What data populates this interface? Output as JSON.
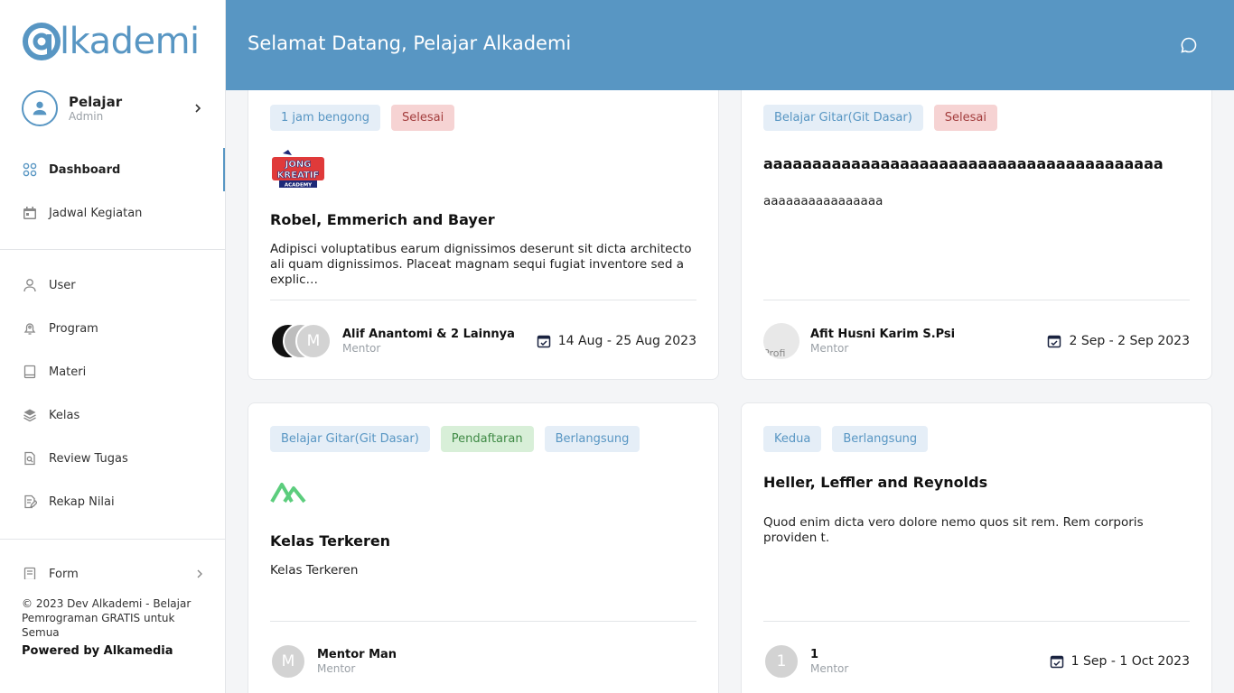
{
  "brand": {
    "logo_text": "lkademi",
    "logo_mark_letter": "a",
    "accent": "#5896c3"
  },
  "profile": {
    "name": "Pelajar",
    "role": "Admin"
  },
  "nav": {
    "dashboard": "Dashboard",
    "jadwal": "Jadwal Kegiatan",
    "user": "User",
    "program": "Program",
    "materi": "Materi",
    "kelas": "Kelas",
    "review": "Review Tugas",
    "rekap": "Rekap Nilai",
    "form": "Form"
  },
  "footer": {
    "copyright": "© 2023 Dev Alkademi - Belajar Pemrograman GRATIS untuk Semua",
    "powered": "Powered by Alkamedia"
  },
  "header": {
    "title": "Selamat Datang, Pelajar Alkademi"
  },
  "cards": [
    {
      "tags": [
        "1 jam bengong",
        "Selesai"
      ],
      "logo_lines": [
        "JONG",
        "KREATIF",
        "ACADEMY"
      ],
      "title": "Robel, Emmerich and Bayer",
      "description": "Adipisci voluptatibus earum dignissimos deserunt sit dicta architecto ali quam dignissimos. Placeat magnam sequi fugiat inventore sed a explic…",
      "avatar_initial": "M",
      "mentor_name": "Alif Anantomi & 2 Lainnya",
      "mentor_role": "Mentor",
      "date": "14 Aug - 25 Aug 2023"
    },
    {
      "tags": [
        "Belajar Gitar(Git Dasar)",
        "Selesai"
      ],
      "title": "aaaaaaaaaaaaaaaaaaaaaaaaaaaaaaaaaaaaaaaaa",
      "description": "aaaaaaaaaaaaaaaa",
      "avatar_alt": "Profi",
      "mentor_name": "Afit Husni Karim S.Psi",
      "mentor_role": "Mentor",
      "date": "2 Sep - 2 Sep 2023"
    },
    {
      "tags": [
        "Belajar Gitar(Git Dasar)",
        "Pendaftaran",
        "Berlangsung"
      ],
      "title": "Kelas Terkeren",
      "description": "Kelas Terkeren",
      "avatar_initial": "M",
      "mentor_name": "Mentor Man",
      "mentor_role": "Mentor"
    },
    {
      "tags": [
        "Kedua",
        "Berlangsung"
      ],
      "title": "Heller, Leffler and Reynolds",
      "description": "Quod enim dicta vero dolore nemo quos sit rem. Rem corporis providen t.",
      "avatar_initial": "1",
      "mentor_name": "1",
      "mentor_role": "Mentor",
      "date": "1 Sep - 1 Oct 2023"
    }
  ]
}
